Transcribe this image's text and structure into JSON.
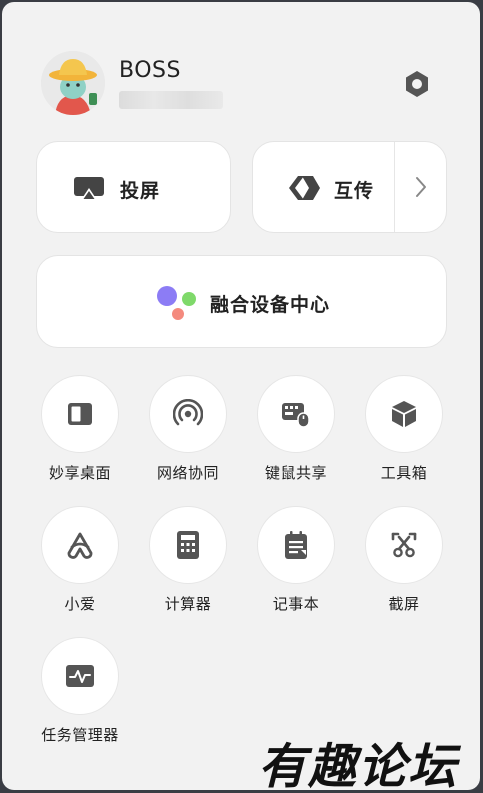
{
  "profile": {
    "username": "BOSS",
    "account": ""
  },
  "settings": {
    "icon": "gear-hexagon-icon"
  },
  "cards": {
    "screen_project": {
      "label": "投屏",
      "icon": "screen-cast-icon"
    },
    "transfer": {
      "label": "互传",
      "icon": "transfer-icon",
      "arrow_icon": "chevron-right-icon"
    },
    "device_hub": {
      "label": "融合设备中心",
      "icon": "device-hub-dots-icon"
    }
  },
  "tools": [
    {
      "label": "妙享桌面",
      "icon": "desktop-split-icon"
    },
    {
      "label": "网络协同",
      "icon": "network-signal-icon"
    },
    {
      "label": "键鼠共享",
      "icon": "keyboard-mouse-icon"
    },
    {
      "label": "工具箱",
      "icon": "cube-icon"
    },
    {
      "label": "小爱",
      "icon": "xiaoai-icon"
    },
    {
      "label": "计算器",
      "icon": "calculator-icon"
    },
    {
      "label": "记事本",
      "icon": "notepad-icon"
    },
    {
      "label": "截屏",
      "icon": "scissors-icon"
    },
    {
      "label": "任务管理器",
      "icon": "activity-monitor-icon"
    }
  ],
  "watermark": "有趣论坛",
  "colors": {
    "panel_bg": "#f2f2f2",
    "card_bg": "#ffffff",
    "icon": "#555555",
    "hub_purple": "#8c7cf5",
    "hub_green": "#7fd96a",
    "hub_red": "#f48a7e"
  }
}
